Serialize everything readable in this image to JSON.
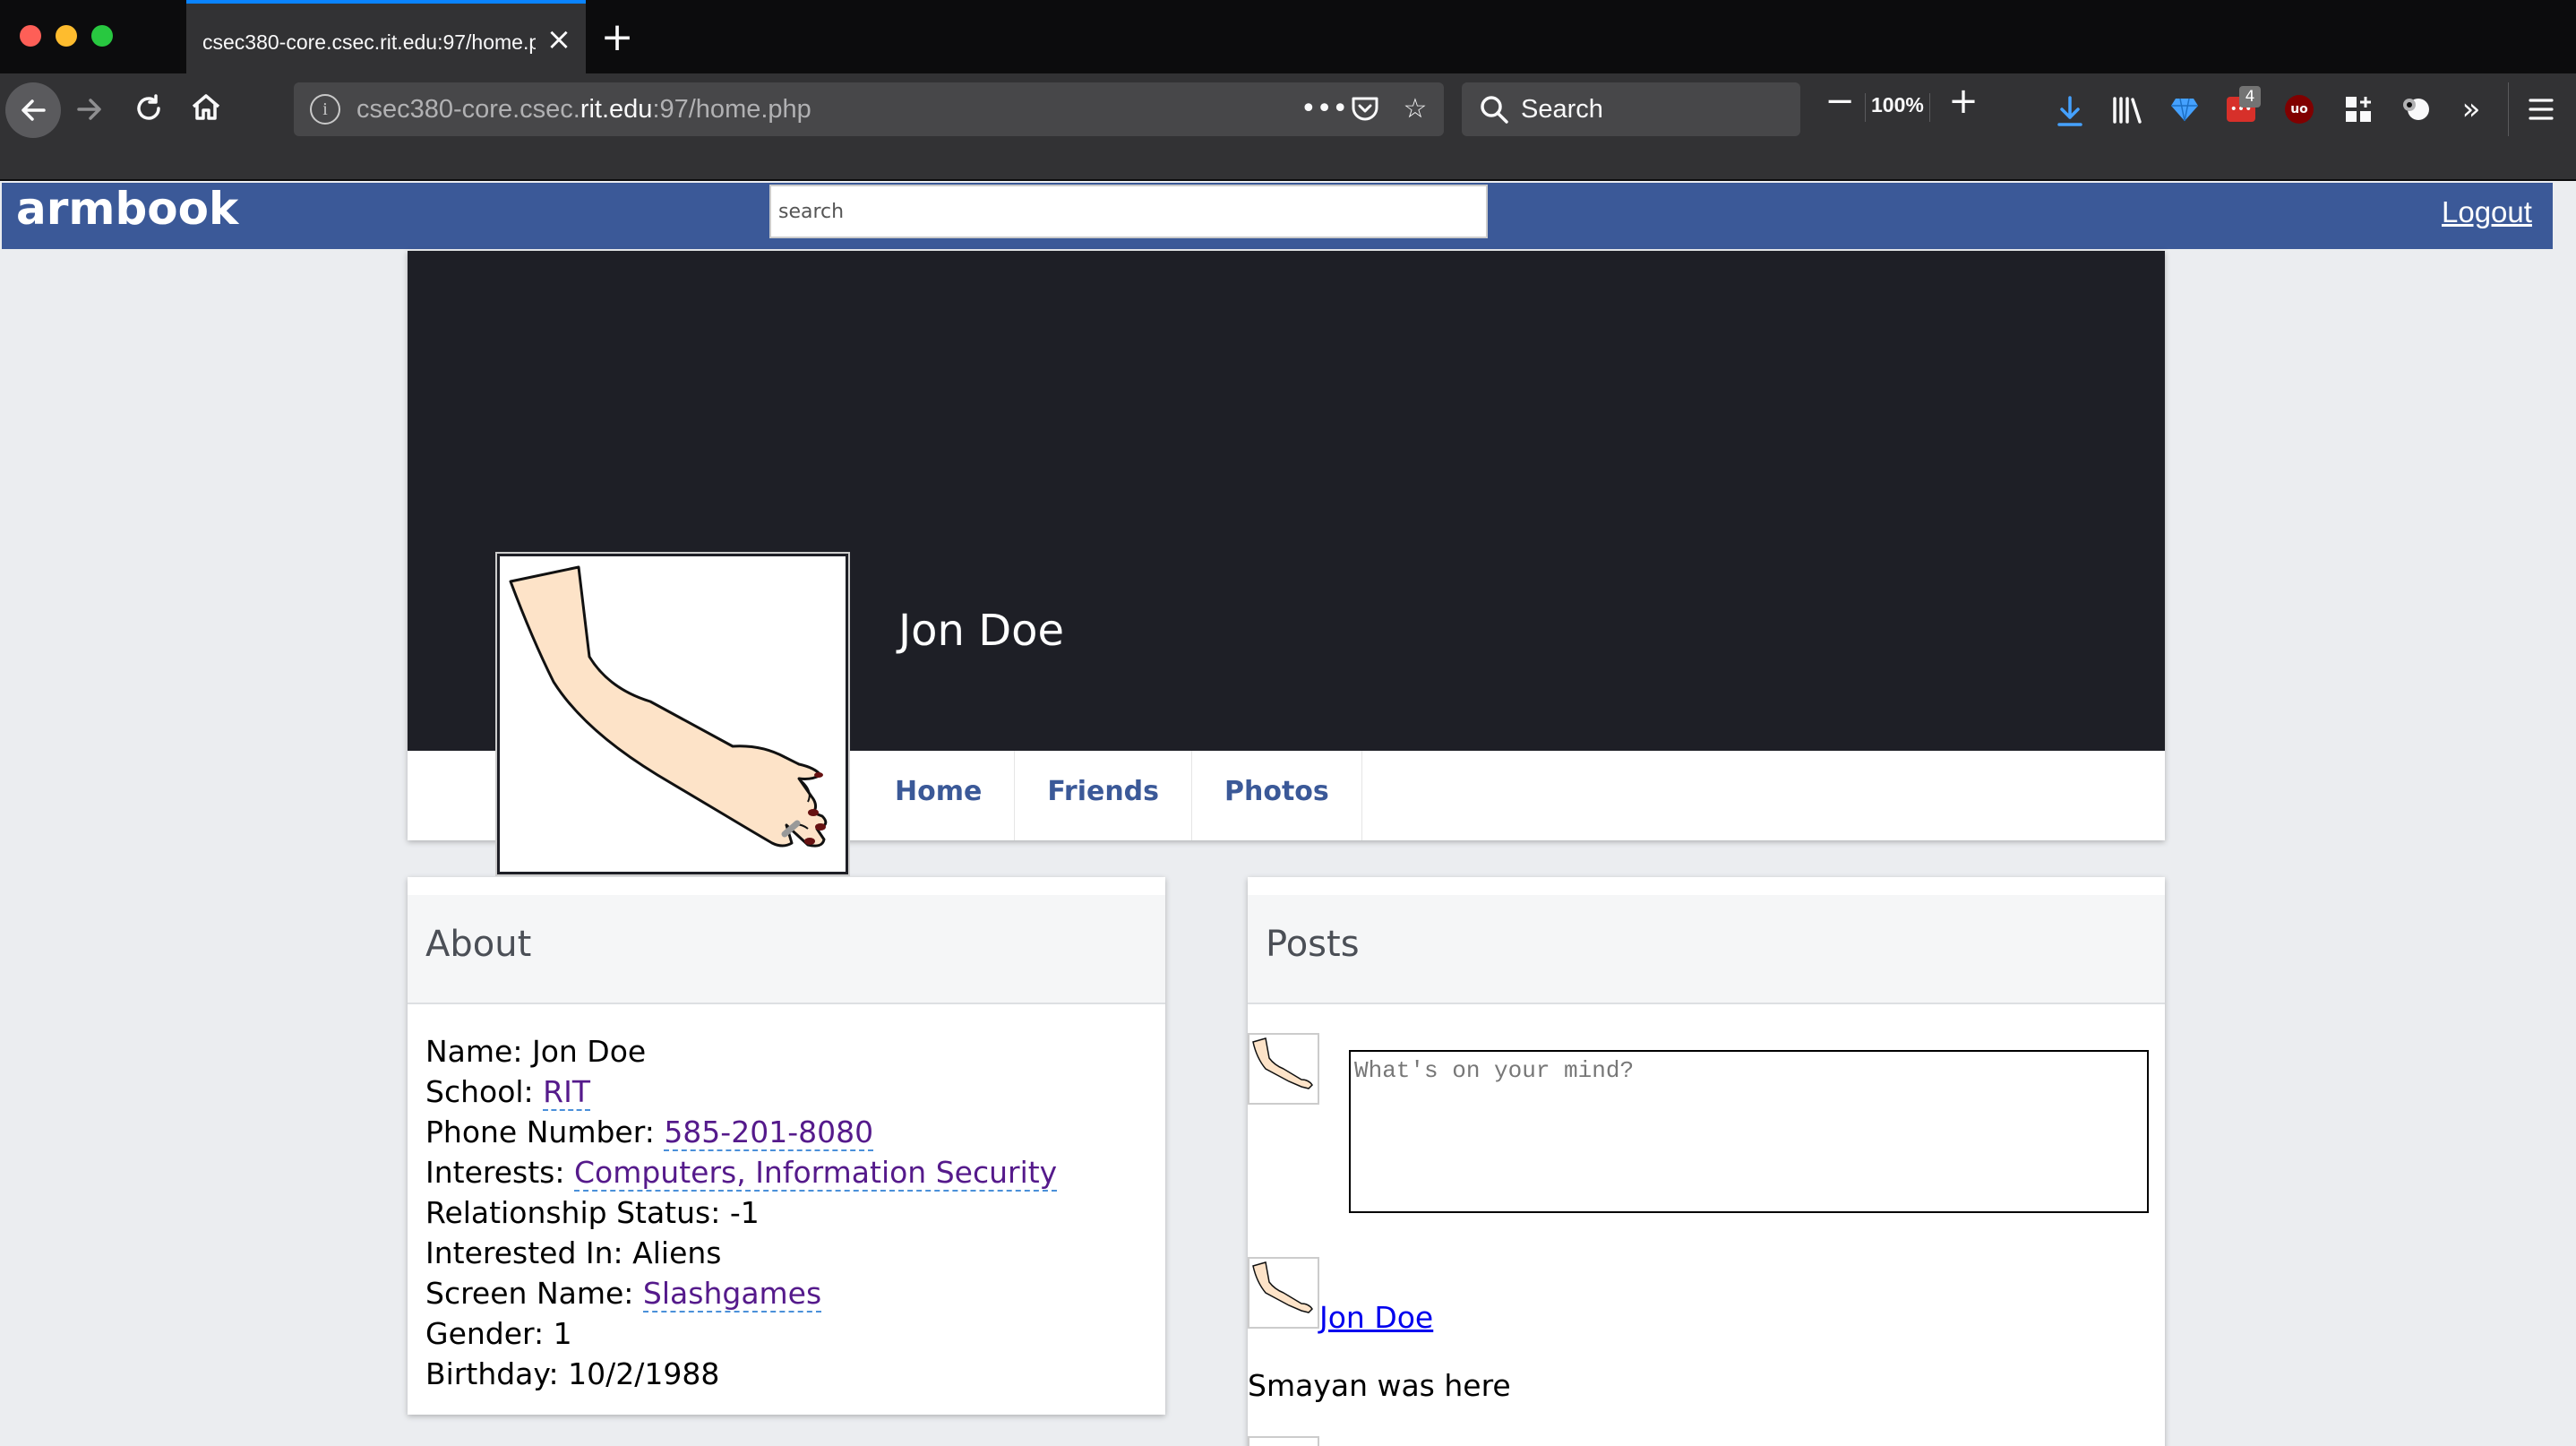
{
  "browser": {
    "tab_title": "csec380-core.csec.rit.edu:97/home.php",
    "url_prefix": "csec380-core.csec.",
    "url_host": "rit.edu",
    "url_suffix": ":97/home.php",
    "search_placeholder": "Search",
    "zoom_level": "100%",
    "badge_count": "4",
    "accent_color": "#0a84ff"
  },
  "site": {
    "logo": "armbook",
    "search_placeholder": "search",
    "logout_label": "Logout",
    "brand_color": "#3b5998"
  },
  "profile": {
    "name": "Jon Doe",
    "nav": [
      "Home",
      "Friends",
      "Photos"
    ]
  },
  "about": {
    "title": "About",
    "fields": {
      "name_label": "Name: ",
      "name": "Jon Doe",
      "school_label": "School: ",
      "school": "RIT",
      "phone_label": "Phone Number: ",
      "phone": "585-201-8080",
      "interests_label": "Interests: ",
      "interests": "Computers, Information Security",
      "relationship_label": "Relationship Status: ",
      "relationship": "-1",
      "interested_in_label": "Interested In: ",
      "interested_in": "Aliens",
      "screen_name_label": "Screen Name: ",
      "screen_name": "Slashgames",
      "gender_label": "Gender: ",
      "gender": "1",
      "birthday_label": "Birthday: ",
      "birthday": "10/2/1988"
    }
  },
  "posts": {
    "title": "Posts",
    "compose_placeholder": "What's on your mind?",
    "items": [
      {
        "author": "Jon Doe",
        "text": "Smayan was here"
      }
    ]
  }
}
